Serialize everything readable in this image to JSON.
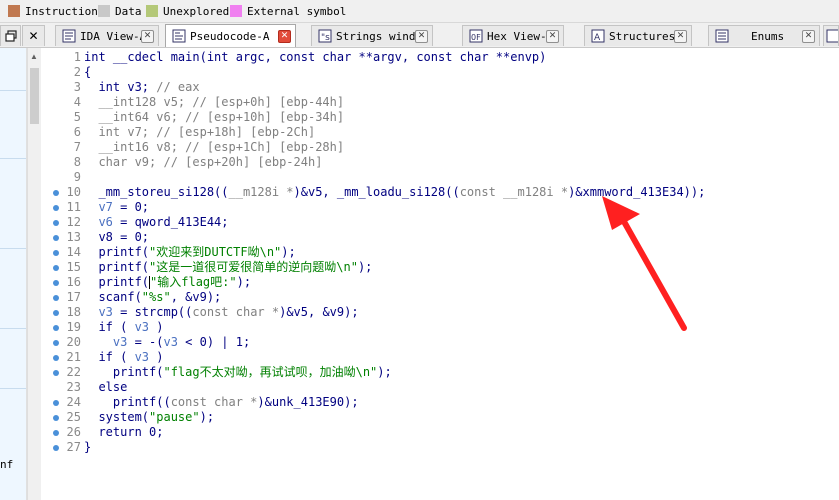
{
  "legend": [
    {
      "label": "Instruction",
      "color": "#c07850"
    },
    {
      "label": "Data",
      "color": "#c8c8c8"
    },
    {
      "label": "Unexplored",
      "color": "#b4c878"
    },
    {
      "label": "External symbol",
      "color": "#f080f0"
    }
  ],
  "tabs": [
    {
      "label": "IDA View-A",
      "active": false
    },
    {
      "label": "Pseudocode-A",
      "active": true
    },
    {
      "label": "Strings window",
      "active": false
    },
    {
      "label": "Hex View-1",
      "active": false
    },
    {
      "label": "Structures",
      "active": false
    },
    {
      "label": "Enums",
      "active": false
    }
  ],
  "left_panel": {
    "truncated_text": "nf"
  },
  "code": {
    "line_numbers": [
      "1",
      "2",
      "3",
      "4",
      "5",
      "6",
      "7",
      "8",
      "9",
      "10",
      "11",
      "12",
      "13",
      "14",
      "15",
      "16",
      "17",
      "18",
      "19",
      "20",
      "21",
      "22",
      "23",
      "24",
      "25",
      "26",
      "27"
    ],
    "l1": "int __cdecl main(int argc, const char **argv, const char **envp)",
    "l2": "{",
    "l3a": "  int v3; ",
    "l3b": "// eax",
    "l4a": "  __int128 v5; ",
    "l4b": "// [esp+0h] [ebp-44h]",
    "l5a": "  __int64 v6; ",
    "l5b": "// [esp+10h] [ebp-34h]",
    "l6a": "  int v7; ",
    "l6b": "// [esp+18h] [ebp-2Ch]",
    "l7a": "  __int16 v8; ",
    "l7b": "// [esp+1Ch] [ebp-28h]",
    "l8a": "  char v9; ",
    "l8b": "// [esp+20h] [ebp-24h]",
    "l10a": "  _mm_storeu_si128((",
    "l10b": "__m128i *",
    "l10c": ")&v5, _mm_loadu_si128((",
    "l10d": "const __m128i *",
    "l10e": ")&xmmword_413E34));",
    "l11a": "  v7",
    "l11b": " = 0;",
    "l12a": "  v6",
    "l12b": " = qword_413E44;",
    "l13": "  v8 = 0;",
    "l14a": "  printf(",
    "l14b": "\"欢迎来到DUTCTF呦\\n\"",
    "l14c": ");",
    "l15a": "  printf(",
    "l15b": "\"这是一道很可爱很简单的逆向题呦\\n\"",
    "l15c": ");",
    "l16a": "  printf(",
    "l16b": "\"输入flag吧:\"",
    "l16c": ");",
    "l17a": "  scanf(",
    "l17b": "\"%s\"",
    "l17c": ", &v9);",
    "l18a": "  v3",
    "l18b": " = strcmp((",
    "l18c": "const char *",
    "l18d": ")&v5, &v9);",
    "l19a": "  if ( ",
    "l19b": "v3",
    "l19c": " )",
    "l20a": "    v3",
    "l20b": " = -(",
    "l20c": "v3",
    "l20d": " < 0) | 1;",
    "l21a": "  if ( ",
    "l21b": "v3",
    "l21c": " )",
    "l22a": "    printf(",
    "l22b": "\"flag不太对呦，再试试呗，加油呦\\n\"",
    "l22c": ");",
    "l23": "  else",
    "l24a": "    printf((",
    "l24b": "const char *",
    "l24c": ")&unk_413E90);",
    "l25a": "  system(",
    "l25b": "\"pause\"",
    "l25c": ");",
    "l26": "  return 0;",
    "l27": "}"
  }
}
